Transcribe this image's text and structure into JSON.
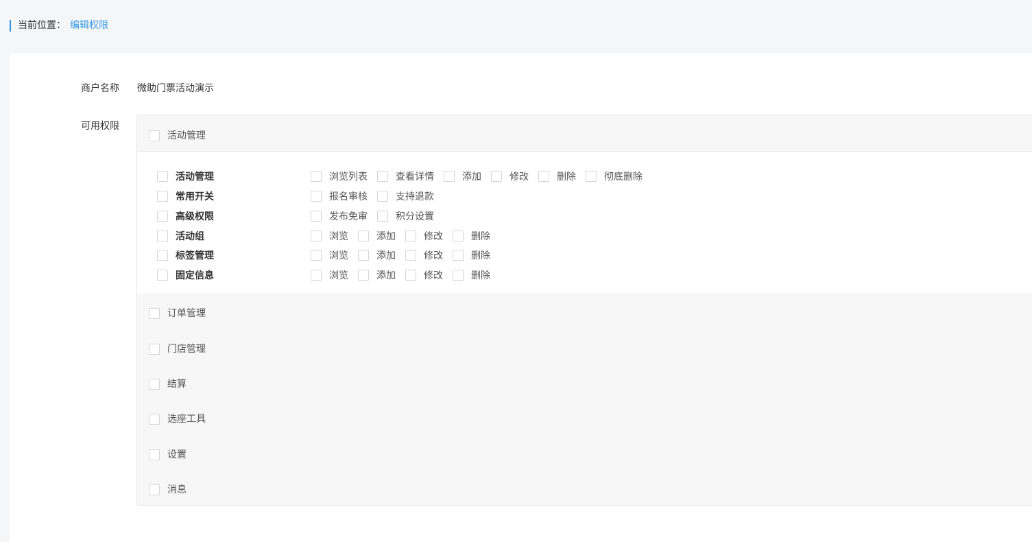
{
  "breadcrumb": {
    "label": "当前位置：",
    "current": "编辑权限"
  },
  "merchant": {
    "label": "商户名称",
    "value": "微助门票活动演示"
  },
  "permissions": {
    "label": "可用权限",
    "expanded_group": "活动管理",
    "rows": [
      {
        "name": "活动管理",
        "options": [
          "浏览列表",
          "查看详情",
          "添加",
          "修改",
          "删除",
          "彻底删除"
        ]
      },
      {
        "name": "常用开关",
        "options": [
          "报名审核",
          "支持退款"
        ]
      },
      {
        "name": "高级权限",
        "options": [
          "发布免审",
          "积分设置"
        ]
      },
      {
        "name": "活动组",
        "options": [
          "浏览",
          "添加",
          "修改",
          "删除"
        ]
      },
      {
        "name": "标签管理",
        "options": [
          "浏览",
          "添加",
          "修改",
          "删除"
        ]
      },
      {
        "name": "固定信息",
        "options": [
          "浏览",
          "添加",
          "修改",
          "删除"
        ]
      }
    ],
    "groups": [
      "订单管理",
      "门店管理",
      "结算",
      "选座工具",
      "设置",
      "消息"
    ]
  },
  "colors": {
    "accent": "#2f8fe8",
    "link": "#3a9ae6",
    "page_bg": "#f5f6f8",
    "box_bg": "#f7f7f7"
  }
}
